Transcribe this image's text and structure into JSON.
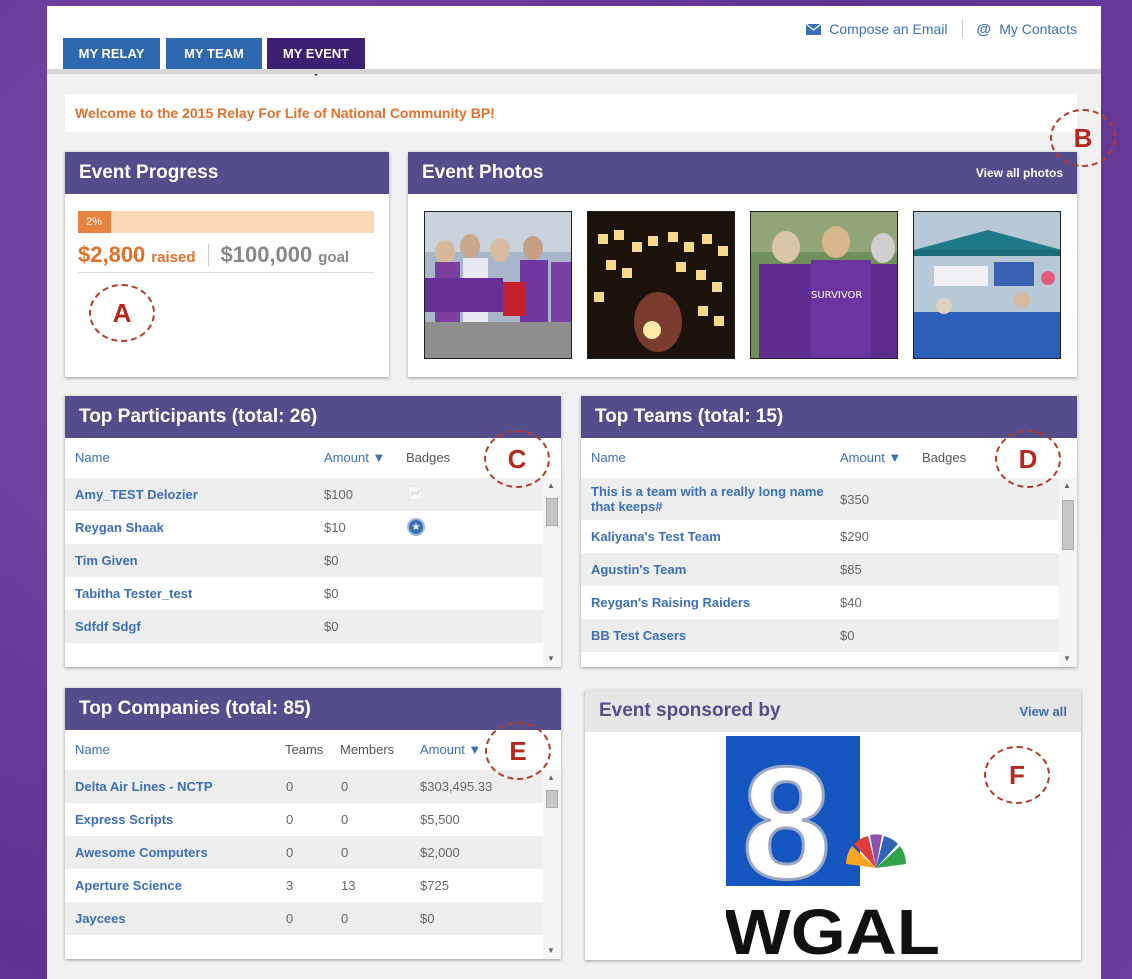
{
  "tabs": [
    {
      "label": "MY RELAY"
    },
    {
      "label": "MY TEAM"
    },
    {
      "label": "MY EVENT"
    }
  ],
  "toplinks": {
    "compose": "Compose an Email",
    "contacts": "My Contacts"
  },
  "welcome": "Welcome to the 2015 Relay For Life of National Community BP!",
  "progress": {
    "title": "Event Progress",
    "percent_label": "2%",
    "percent_value": 0.028,
    "raised": "$2,800",
    "raised_label": "raised",
    "goal": "$100,000",
    "goal_label": "goal"
  },
  "photos": {
    "title": "Event Photos",
    "view_all": "View all photos"
  },
  "participants": {
    "title": "Top Participants (total: 26)",
    "col_name": "Name",
    "col_amount": "Amount ▼",
    "col_badges": "Badges",
    "rows": [
      {
        "name": "Amy_TEST Delozier",
        "amount": "$100"
      },
      {
        "name": "Reygan Shaak",
        "amount": "$10"
      },
      {
        "name": "Tim Given",
        "amount": "$0"
      },
      {
        "name": "Tabitha Tester_test",
        "amount": "$0"
      },
      {
        "name": "Sdfdf Sdgf",
        "amount": "$0"
      }
    ]
  },
  "teams": {
    "title": "Top Teams (total: 15)",
    "col_name": "Name",
    "col_amount": "Amount ▼",
    "col_badges": "Badges",
    "rows": [
      {
        "name": "This is a team with a really long name that keeps#",
        "amount": "$350"
      },
      {
        "name": "Kaliyana's Test Team",
        "amount": "$290"
      },
      {
        "name": "Agustin's Team",
        "amount": "$85"
      },
      {
        "name": "Reygan's Raising Raiders",
        "amount": "$40"
      },
      {
        "name": "BB Test Casers",
        "amount": "$0"
      }
    ]
  },
  "companies": {
    "title": "Top Companies (total: 85)",
    "col_name": "Name",
    "col_teams": "Teams",
    "col_members": "Members",
    "col_amount": "Amount ▼",
    "rows": [
      {
        "name": "Delta Air Lines - NCTP",
        "teams": "0",
        "members": "0",
        "amount": "$303,495.33"
      },
      {
        "name": "Express Scripts",
        "teams": "0",
        "members": "0",
        "amount": "$5,500"
      },
      {
        "name": "Awesome Computers",
        "teams": "0",
        "members": "0",
        "amount": "$2,000"
      },
      {
        "name": "Aperture Science",
        "teams": "3",
        "members": "13",
        "amount": "$725"
      },
      {
        "name": "Jaycees",
        "teams": "0",
        "members": "0",
        "amount": "$0"
      }
    ]
  },
  "sponsor": {
    "title": "Event sponsored by",
    "view_all": "View all",
    "logo_number": "8",
    "logo_text": "WGAL"
  },
  "markers": [
    "A",
    "B",
    "C",
    "D",
    "E",
    "F"
  ],
  "colors": {
    "header": "#534d8b",
    "accent": "#e0702a",
    "link": "#3b6fb6",
    "tab": "#2e68b0",
    "tab_active": "#3d1f74"
  }
}
